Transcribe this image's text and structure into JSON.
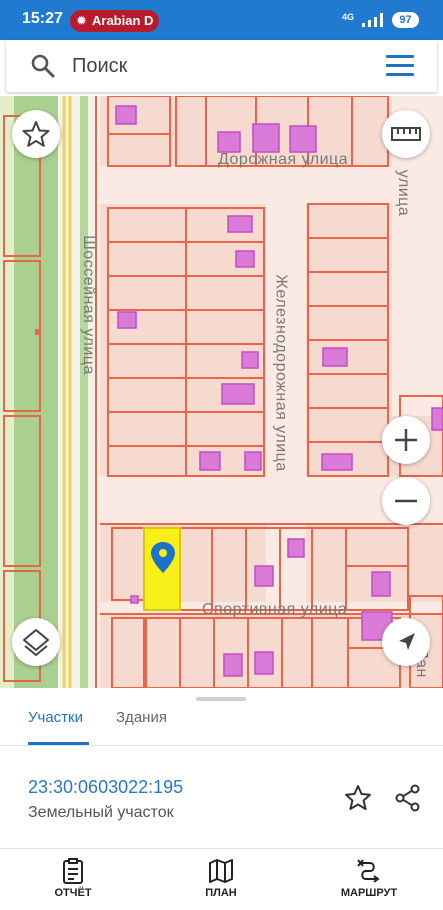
{
  "status_bar": {
    "time": "15:27",
    "notification": "Arabian D",
    "network": "4G",
    "battery": "97"
  },
  "search": {
    "placeholder": "Поиск"
  },
  "map": {
    "streets": {
      "dorozhnaya": "Дорожная улица",
      "shosseynaya": "Шоссейная улица",
      "zheleznodorozhnaya": "Железнодорожная улица",
      "sportivnaya": "Спортивная улица",
      "top_right": "улица",
      "bottom_right": "Лан"
    }
  },
  "sheet": {
    "tabs": [
      {
        "label": "Участки",
        "active": true
      },
      {
        "label": "Здания",
        "active": false
      }
    ],
    "parcel": {
      "cadastral_number": "23:30:0603022:195",
      "type": "Земельный участок"
    }
  },
  "bottom_nav": {
    "items": [
      {
        "label": "ОТЧЁТ",
        "icon": "report-icon"
      },
      {
        "label": "ПЛАН",
        "icon": "map-plan-icon"
      },
      {
        "label": "МАРШРУТ",
        "icon": "route-icon"
      }
    ]
  },
  "colors": {
    "accent": "#1a73c8",
    "status_bar": "#1f7ad0",
    "parcel_fill": "#f6d9cf",
    "parcel_border": "#e8654a",
    "building": "#d97ad9",
    "selected_parcel": "#f7ee1a"
  }
}
